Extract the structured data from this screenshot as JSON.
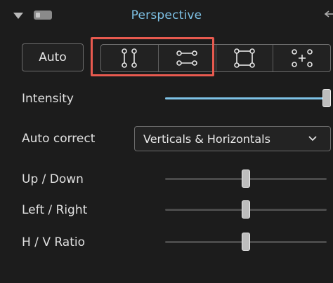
{
  "panel": {
    "title": "Perspective"
  },
  "auto_button": {
    "label": "Auto"
  },
  "modes": [
    {
      "name": "vertical",
      "icon": "vertical-lines-icon"
    },
    {
      "name": "horizontal",
      "icon": "horizontal-lines-icon"
    },
    {
      "name": "rectangle",
      "icon": "rectangle-icon"
    },
    {
      "name": "guided",
      "icon": "guided-points-icon"
    }
  ],
  "intensity": {
    "label": "Intensity",
    "value": 1.0
  },
  "auto_correct": {
    "label": "Auto correct",
    "value": "Verticals & Horizontals"
  },
  "sliders": [
    {
      "label": "Up / Down",
      "value": 0.5
    },
    {
      "label": "Left / Right",
      "value": 0.5
    },
    {
      "label": "H / V Ratio",
      "value": 0.5
    }
  ],
  "colors": {
    "accent": "#7ec2e6",
    "highlight": "#e85a4f",
    "background": "#1c1c1c"
  }
}
